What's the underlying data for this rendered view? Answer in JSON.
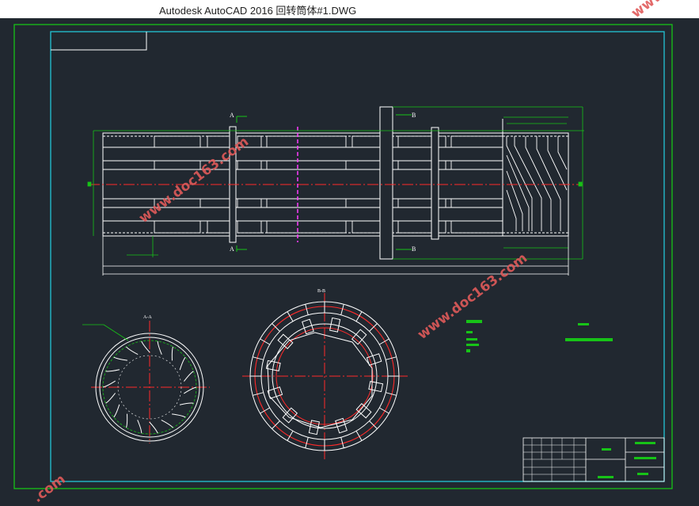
{
  "window": {
    "title": "Autodesk AutoCAD 2016     回转筒体#1.DWG"
  },
  "watermarks": [
    "www.doc163.com",
    "www.doc163.com",
    "www.doc163.com",
    ".com",
    "www"
  ],
  "drawing": {
    "section_a_label": "A",
    "section_b_label": "B",
    "view_a_caption": "A-A",
    "view_b_caption": "B-B"
  },
  "colors": {
    "background": "#212830",
    "frame_green": "#17c317",
    "frame_cyan": "#22c6d6",
    "white_lines": "#ffffff",
    "center_red": "#ff2a2a",
    "magenta": "#ff3cff",
    "watermark_red": "#e05a5a"
  }
}
